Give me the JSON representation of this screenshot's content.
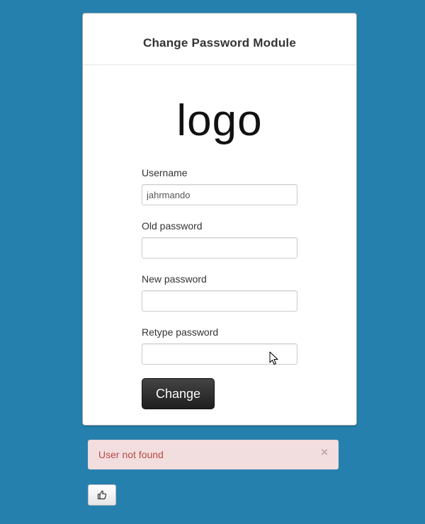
{
  "panel": {
    "title": "Change Password Module",
    "logo_text": "logo"
  },
  "form": {
    "fields": [
      {
        "label": "Username",
        "value": "jahrmando"
      },
      {
        "label": "Old password",
        "value": ""
      },
      {
        "label": "New password",
        "value": ""
      },
      {
        "label": "Retype password",
        "value": ""
      }
    ],
    "submit_label": "Change"
  },
  "alert": {
    "message": "User not found",
    "close_glyph": "×",
    "background_color": "#f2dede",
    "text_color": "#b94a48"
  },
  "like_button": {
    "icon": "thumbs-up-icon"
  },
  "colors": {
    "page_background": "#2680ae",
    "panel_background": "#ffffff",
    "button_background": "#222222"
  }
}
